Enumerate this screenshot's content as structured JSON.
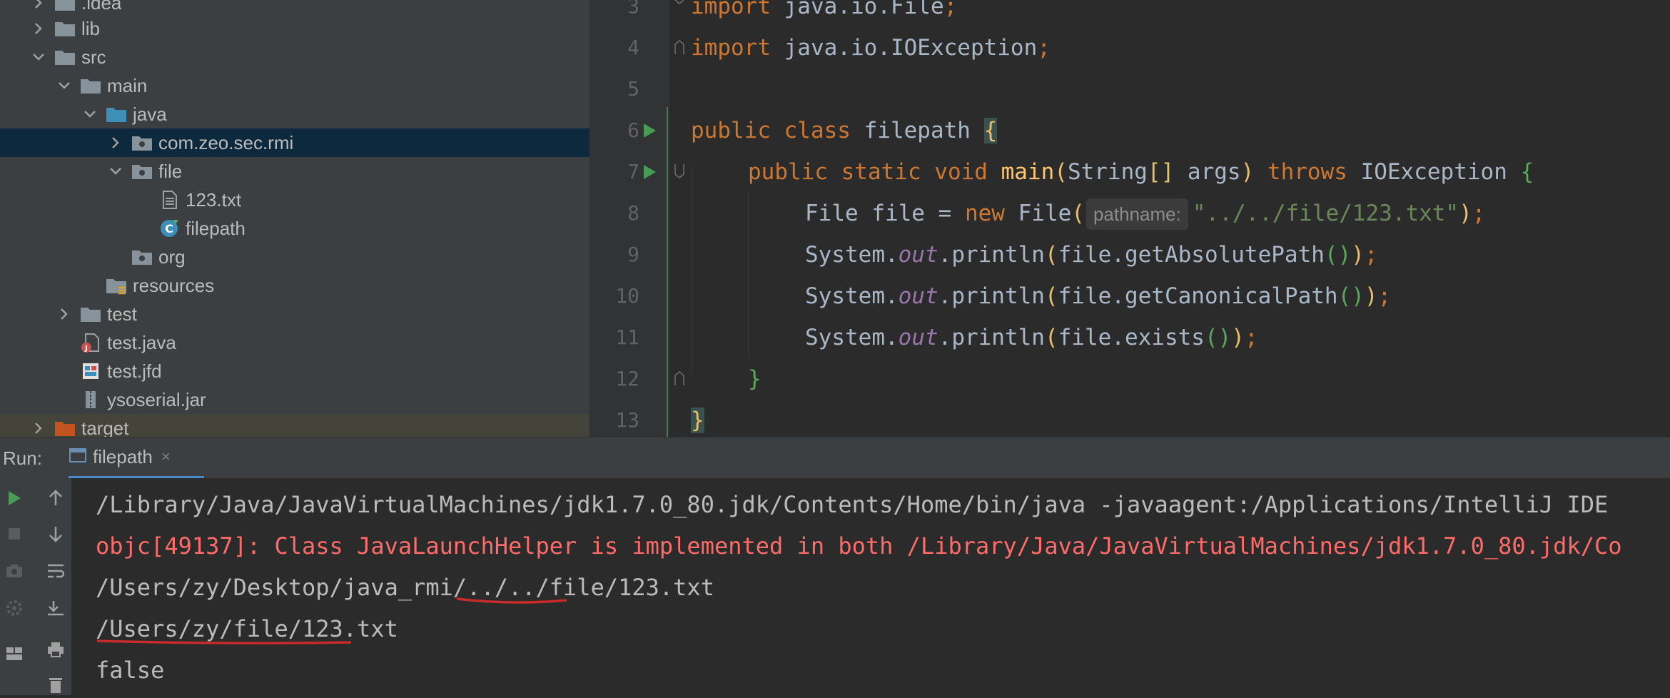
{
  "project_tree": {
    "items": [
      {
        "label": ".idea",
        "icon": "folder-icon",
        "expanded": false
      },
      {
        "label": "lib",
        "icon": "folder-icon",
        "expanded": false
      },
      {
        "label": "src",
        "icon": "folder-icon",
        "expanded": true
      },
      {
        "label": "main",
        "icon": "folder-icon",
        "expanded": true
      },
      {
        "label": "java",
        "icon": "source-folder-icon",
        "expanded": true
      },
      {
        "label": "com.zeo.sec.rmi",
        "icon": "package-icon",
        "expanded": false,
        "selected": true
      },
      {
        "label": "file",
        "icon": "package-icon",
        "expanded": true
      },
      {
        "label": "123.txt",
        "icon": "text-file-icon"
      },
      {
        "label": "filepath",
        "icon": "java-class-icon"
      },
      {
        "label": "org",
        "icon": "package-icon"
      },
      {
        "label": "resources",
        "icon": "resources-folder-icon"
      },
      {
        "label": "test",
        "icon": "folder-icon",
        "expanded": false
      },
      {
        "label": "test.java",
        "icon": "java-file-icon"
      },
      {
        "label": "test.jfd",
        "icon": "jfd-file-icon"
      },
      {
        "label": "ysoserial.jar",
        "icon": "jar-file-icon"
      },
      {
        "label": "target",
        "icon": "excluded-folder-icon",
        "expanded": false
      }
    ]
  },
  "editor": {
    "line_numbers": [
      "3",
      "4",
      "5",
      "6",
      "7",
      "8",
      "9",
      "10",
      "11",
      "12",
      "13"
    ],
    "code": {
      "l3_kw": "import",
      "l3_rest": " java.io.File",
      "l3_semi": ";",
      "l4_kw": "import",
      "l4_rest": " java.io.IOException",
      "l4_semi": ";",
      "l6_kw": "public class ",
      "l6_name": "filepath ",
      "l6_brace": "{",
      "l7_kw": "public static void ",
      "l7_fn": "main",
      "l7_p1": "(",
      "l7_type": "String",
      "l7_arr": "[]",
      "l7_args": " args",
      "l7_p2": ")",
      "l7_throws": " throws ",
      "l7_exc": "IOException ",
      "l7_brace": "{",
      "l8_a": "File file = ",
      "l8_new": "new ",
      "l8_b": "File",
      "l8_p1": "(",
      "l8_hint": "pathname:",
      "l8_str": "\"../../file/123.txt\"",
      "l8_p2": ")",
      "l8_semi": ";",
      "l9_a": "System.",
      "l9_out": "out",
      "l9_b": ".println",
      "l9_p1": "(",
      "l9_c": "file.getAbsolutePath",
      "l9_p2": "()",
      "l9_p3": ")",
      "l9_semi": ";",
      "l10_a": "System.",
      "l10_out": "out",
      "l10_b": ".println",
      "l10_p1": "(",
      "l10_c": "file.getCanonicalPath",
      "l10_p2": "()",
      "l10_p3": ")",
      "l10_semi": ";",
      "l11_a": "System.",
      "l11_out": "out",
      "l11_b": ".println",
      "l11_p1": "(",
      "l11_c": "file.exists",
      "l11_p2": "()",
      "l11_p3": ")",
      "l11_semi": ";",
      "l12_brace": "}",
      "l13_brace": "}"
    }
  },
  "run_panel": {
    "title": "Run:",
    "tab_label": "filepath",
    "tab_close": "×",
    "console_lines": [
      "/Library/Java/JavaVirtualMachines/jdk1.7.0_80.jdk/Contents/Home/bin/java -javaagent:/Applications/IntelliJ IDE",
      "objc[49137]: Class JavaLaunchHelper is implemented in both /Library/Java/JavaVirtualMachines/jdk1.7.0_80.jdk/Co",
      "/Users/zy/Desktop/java_rmi/../../file/123.txt",
      "/Users/zy/file/123.txt",
      "false"
    ],
    "toolbar_icons": [
      "run-icon",
      "stop-icon",
      "camera-icon",
      "settings-icon",
      "layout-icon",
      "up-arrow-icon",
      "down-arrow-icon",
      "soft-wrap-icon",
      "scroll-to-end-icon",
      "print-icon",
      "trash-icon"
    ]
  },
  "colors": {
    "tree_bg": "#3c3f41",
    "editor_bg": "#2b2b2b",
    "keyword": "#cc7832",
    "string": "#6a8759",
    "error": "#ff6b68",
    "annotation_underline": "#c72b2b"
  }
}
